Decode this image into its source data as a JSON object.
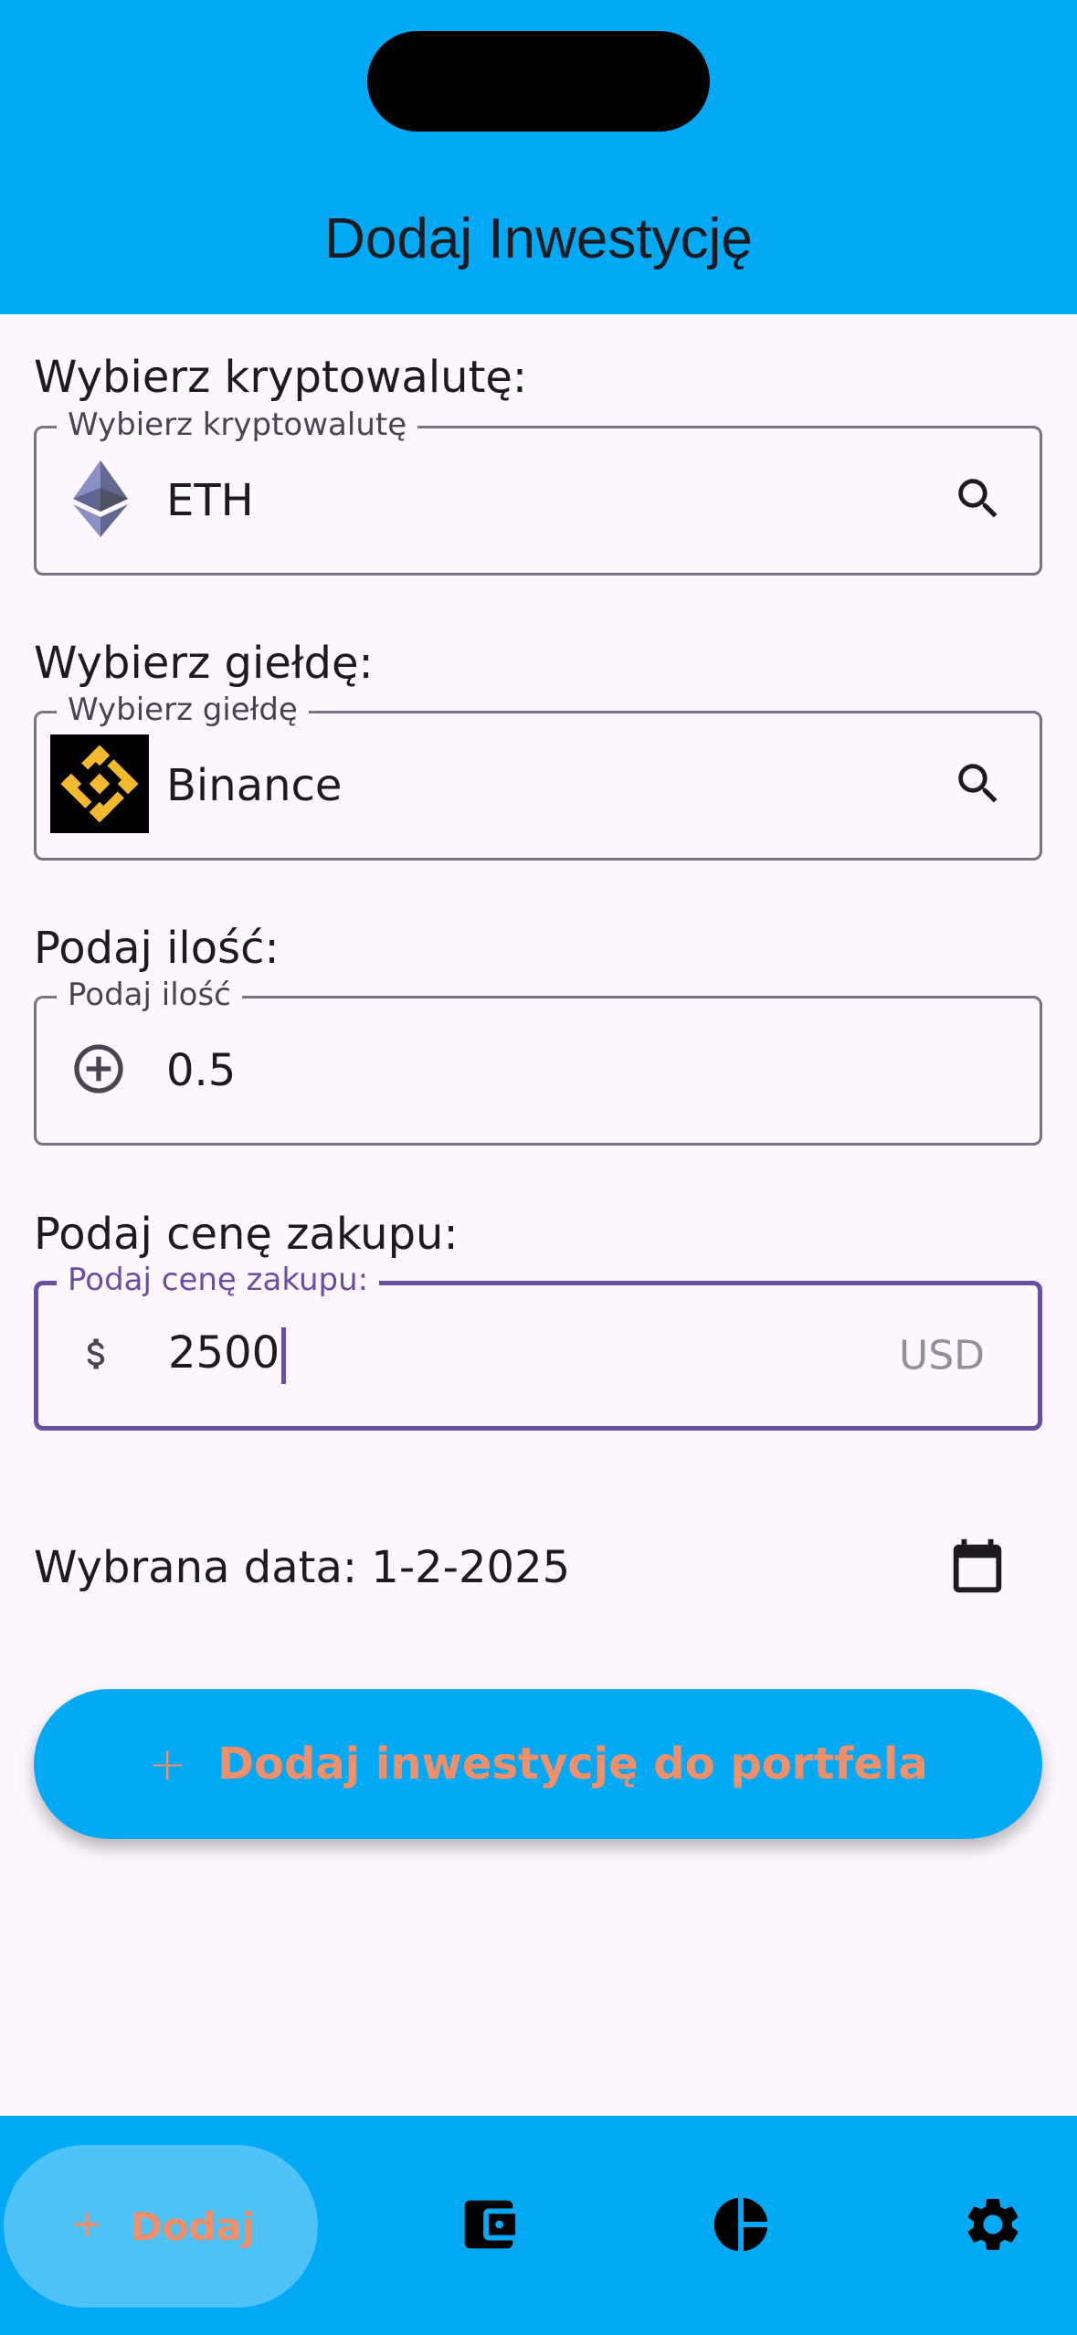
{
  "header": {
    "title": "Dodaj Inwestycję"
  },
  "crypto": {
    "section_label": "Wybierz kryptowalutę:",
    "field_label": "Wybierz kryptowalutę",
    "value": "ETH",
    "icon": "ethereum-logo",
    "trailing_icon": "search-icon"
  },
  "exchange": {
    "section_label": "Wybierz giełdę:",
    "field_label": "Wybierz giełdę",
    "value": "Binance",
    "icon": "binance-logo",
    "trailing_icon": "search-icon"
  },
  "amount": {
    "section_label": "Podaj ilość:",
    "field_label": "Podaj ilość",
    "value": "0.5",
    "icon": "add-circle-icon"
  },
  "price": {
    "section_label": "Podaj cenę zakupu:",
    "field_label": "Podaj cenę zakupu:",
    "value": "2500",
    "suffix": "USD",
    "icon": "dollar-icon"
  },
  "date": {
    "text": "Wybrana data: 1-2-2025",
    "icon": "calendar-icon"
  },
  "submit_button": {
    "label": "Dodaj inwestycję do portfela",
    "icon": "plus-icon"
  },
  "bottom_nav": {
    "items": [
      {
        "label": "Dodaj",
        "icon": "plus-icon",
        "active": true
      },
      {
        "label": "",
        "icon": "wallet-icon",
        "active": false
      },
      {
        "label": "",
        "icon": "pie-chart-icon",
        "active": false
      },
      {
        "label": "",
        "icon": "gear-icon",
        "active": false
      }
    ]
  },
  "colors": {
    "primary": "#03a9f4",
    "background": "#fef7ff",
    "focus": "#6750a4",
    "accent_text": "#f0906b"
  }
}
